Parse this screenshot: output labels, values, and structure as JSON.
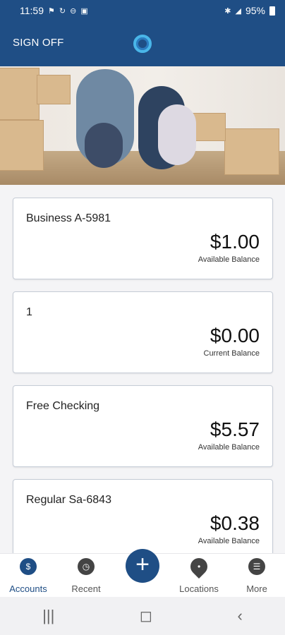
{
  "status": {
    "time": "11:59",
    "left_icons": [
      "notification-icon",
      "sync-icon",
      "minus-circle-icon",
      "document-icon"
    ],
    "right_icons": [
      "vibrate-icon",
      "signal-icon"
    ],
    "battery": "95%"
  },
  "app_bar": {
    "sign_off": "SIGN OFF",
    "logo": "circle-logo-icon",
    "brand_color": "#1f4e85",
    "accent_color": "#49b6e9"
  },
  "accounts": [
    {
      "name": "Business A-5981",
      "balance": "$1.00",
      "balance_label": "Available Balance"
    },
    {
      "name": "1",
      "balance": "$0.00",
      "balance_label": "Current Balance"
    },
    {
      "name": "Free Checking",
      "balance": "$5.57",
      "balance_label": "Available Balance"
    },
    {
      "name": "Regular Sa-6843",
      "balance": "$0.38",
      "balance_label": "Available Balance"
    }
  ],
  "bottom_nav": {
    "items": [
      {
        "label": "Accounts",
        "icon": "accounts-icon"
      },
      {
        "label": "Recent",
        "icon": "clock-icon"
      },
      {
        "label": "Locations",
        "icon": "location-pin-icon"
      },
      {
        "label": "More",
        "icon": "more-menu-icon"
      }
    ],
    "fab_icon": "plus-icon"
  },
  "system_nav": [
    "recent-apps-icon",
    "home-icon",
    "back-icon"
  ]
}
